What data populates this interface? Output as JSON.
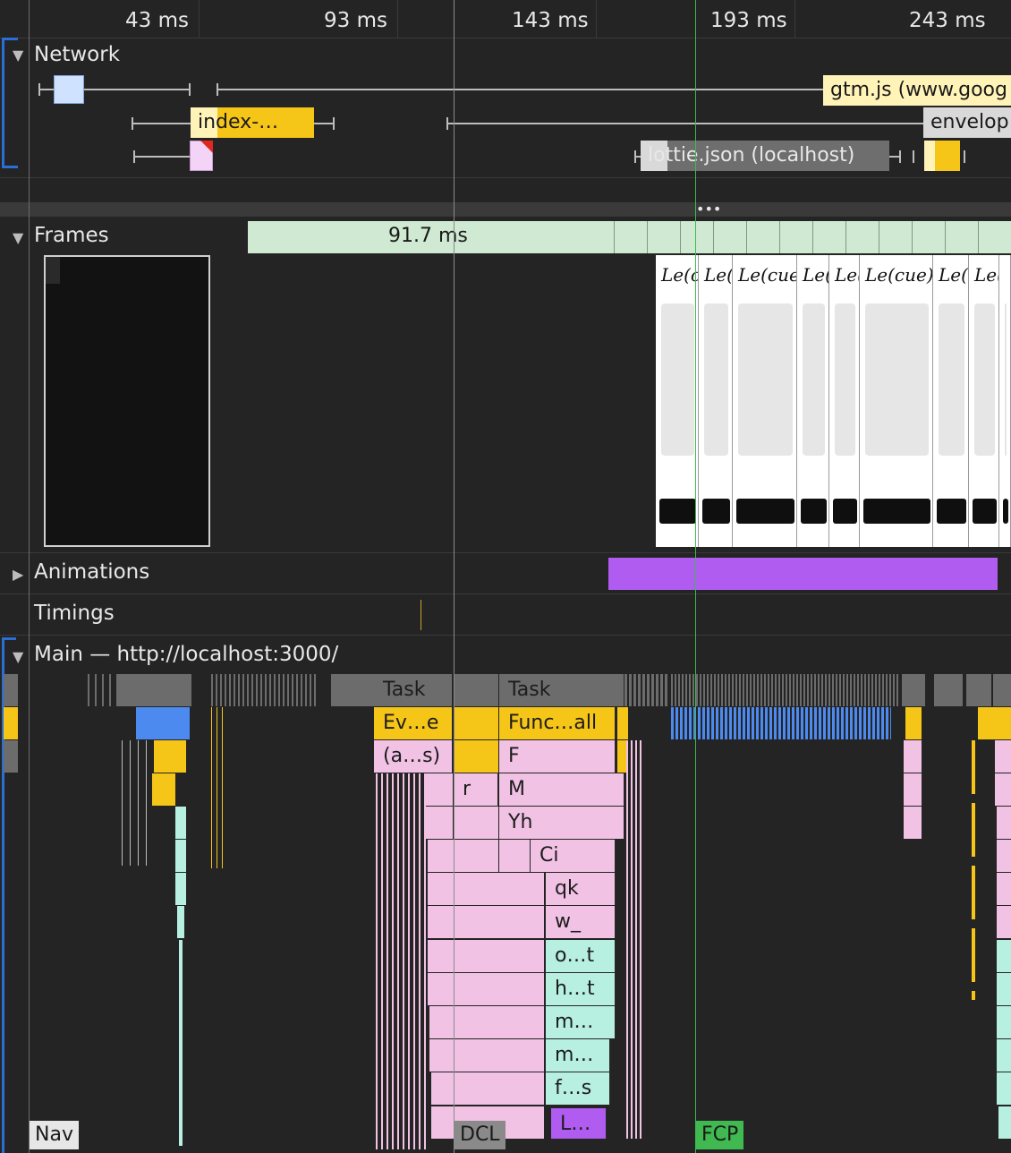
{
  "ruler": {
    "ticks": [
      "43 ms",
      "93 ms",
      "143 ms",
      "193 ms",
      "243 ms"
    ]
  },
  "network": {
    "title": "Network",
    "requests": [
      "gtm.js (www.goog",
      "index-…",
      "envelop",
      "lottie.json (localhost)"
    ]
  },
  "frames": {
    "title": "Frames",
    "frame_duration": "91.7 ms",
    "logo_text": "Le(cue)"
  },
  "animations": {
    "title": "Animations"
  },
  "timings": {
    "title": "Timings"
  },
  "main": {
    "title": "Main — http://localhost:3000/",
    "tasks": [
      "Task",
      "Task"
    ],
    "calls": {
      "ev": "Ev…e",
      "func": "Func…all",
      "as": "(a…s)",
      "f": "F",
      "r": "r",
      "m": "M",
      "yh": "Yh",
      "ci": "Ci",
      "qk": "qk",
      "w": "w_",
      "ot": "o…t",
      "ht": "h…t",
      "m1": "m…",
      "m2": "m…",
      "fs": "f…s",
      "l": "L…"
    }
  },
  "markers": {
    "nav": "Nav",
    "dcl": "DCL",
    "fcp": "FCP"
  },
  "colors": {
    "script": "#f5c518",
    "render": "#f1c2e4",
    "paint": "#b7efe0",
    "task": "#6c6c6c",
    "animation": "#b05cf0",
    "fcp_line": "#3fb950"
  }
}
